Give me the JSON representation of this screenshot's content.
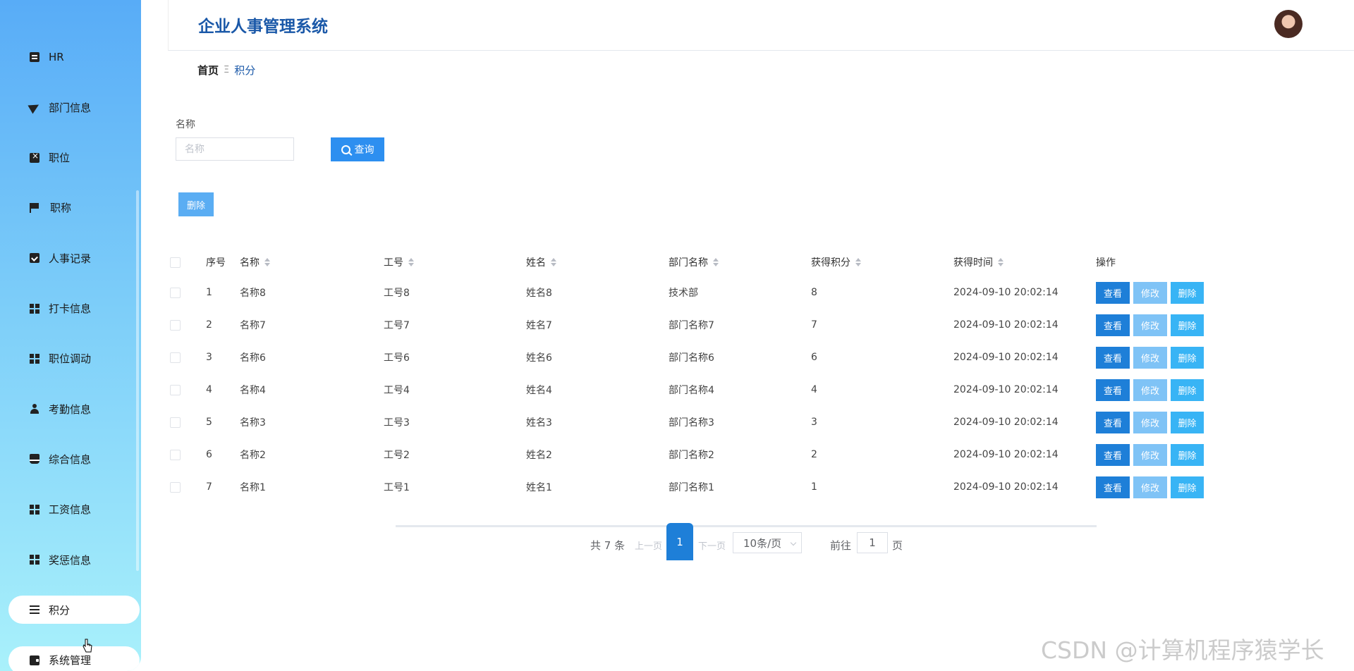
{
  "app": {
    "title": "企业人事管理系统"
  },
  "sidebar": {
    "items": [
      {
        "label": "HR",
        "icon": "clipboard-icon",
        "active": false
      },
      {
        "label": "部门信息",
        "icon": "paper-plane-icon",
        "active": false
      },
      {
        "label": "职位",
        "icon": "box-icon",
        "active": false
      },
      {
        "label": "职称",
        "icon": "flag-icon",
        "active": false
      },
      {
        "label": "人事记录",
        "icon": "clipboard-check-icon",
        "active": false
      },
      {
        "label": "打卡信息",
        "icon": "grid-icon",
        "active": false
      },
      {
        "label": "职位调动",
        "icon": "grid-icon",
        "active": false
      },
      {
        "label": "考勤信息",
        "icon": "user-icon",
        "active": false
      },
      {
        "label": "综合信息",
        "icon": "inbox-icon",
        "active": false
      },
      {
        "label": "工资信息",
        "icon": "grid-icon",
        "active": false
      },
      {
        "label": "奖惩信息",
        "icon": "grid-icon",
        "active": false
      },
      {
        "label": "积分",
        "icon": "list-icon",
        "active": true
      },
      {
        "label": "系统管理",
        "icon": "wallet-icon",
        "active": true
      }
    ]
  },
  "breadcrumb": {
    "home": "首页",
    "separator": "Ξ",
    "current": "积分"
  },
  "search": {
    "label": "名称",
    "placeholder": "名称",
    "value": "",
    "button_label": "查询"
  },
  "toolbar": {
    "delete_label": "删除"
  },
  "table": {
    "headers": {
      "index": "序号",
      "name": "名称",
      "job_no": "工号",
      "person": "姓名",
      "dept": "部门名称",
      "points": "获得积分",
      "time": "获得时间",
      "ops": "操作"
    },
    "rows": [
      {
        "index": "1",
        "name": "名称8",
        "job_no": "工号8",
        "person": "姓名8",
        "dept": "技术部",
        "points": "8",
        "time": "2024-09-10 20:02:14"
      },
      {
        "index": "2",
        "name": "名称7",
        "job_no": "工号7",
        "person": "姓名7",
        "dept": "部门名称7",
        "points": "7",
        "time": "2024-09-10 20:02:14"
      },
      {
        "index": "3",
        "name": "名称6",
        "job_no": "工号6",
        "person": "姓名6",
        "dept": "部门名称6",
        "points": "6",
        "time": "2024-09-10 20:02:14"
      },
      {
        "index": "4",
        "name": "名称4",
        "job_no": "工号4",
        "person": "姓名4",
        "dept": "部门名称4",
        "points": "4",
        "time": "2024-09-10 20:02:14"
      },
      {
        "index": "5",
        "name": "名称3",
        "job_no": "工号3",
        "person": "姓名3",
        "dept": "部门名称3",
        "points": "3",
        "time": "2024-09-10 20:02:14"
      },
      {
        "index": "6",
        "name": "名称2",
        "job_no": "工号2",
        "person": "姓名2",
        "dept": "部门名称2",
        "points": "2",
        "time": "2024-09-10 20:02:14"
      },
      {
        "index": "7",
        "name": "名称1",
        "job_no": "工号1",
        "person": "姓名1",
        "dept": "部门名称1",
        "points": "1",
        "time": "2024-09-10 20:02:14"
      }
    ],
    "actions": {
      "view": "查看",
      "edit": "修改",
      "delete": "删除"
    }
  },
  "pagination": {
    "total": "共 7 条",
    "prev": "上一页",
    "current": "1",
    "next": "下一页",
    "page_size": "10条/页",
    "goto": "前往",
    "goto_value": "1",
    "page_suffix": "页"
  },
  "watermark": "CSDN @计算机程序猿学长",
  "colors": {
    "primary": "#1e7fd8",
    "title": "#1a58a8",
    "edit": "#7fc3f6",
    "delete": "#38b4f5"
  }
}
